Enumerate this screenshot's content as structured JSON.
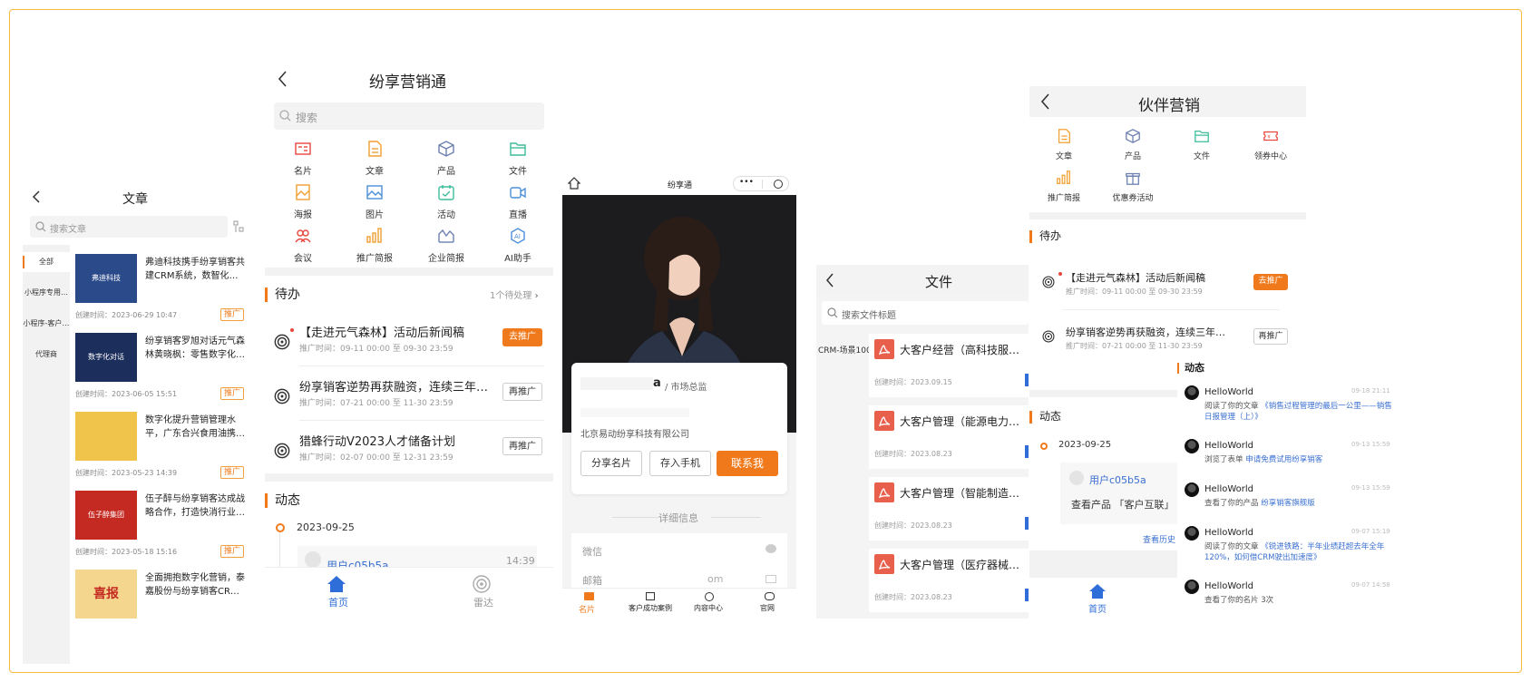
{
  "articles": {
    "title": "文章",
    "search_placeholder": "搜索文章",
    "categories": [
      "全部",
      "小程序专用…",
      "小程序-客户…",
      "代理商"
    ],
    "items": [
      {
        "title": "弗迪科技携手纷享销客共建CRM系统，数智化…",
        "date": "创建时间：2023-06-29 10:47",
        "tag": "推广",
        "thumb_text": "弗迪科技"
      },
      {
        "title": "纷享销客罗旭对话元气森林黄晓枫：零售数字化…",
        "date": "创建时间：2023-06-05 15:51",
        "tag": "推广",
        "thumb_text": "数字化对话"
      },
      {
        "title": "数字化提升营销管理水平，广东合兴食用油携…",
        "date": "创建时间：2023-05-23 14:39",
        "tag": "推广",
        "thumb_text": ""
      },
      {
        "title": "伍子醉与纷享销客达成战略合作，打造快消行业…",
        "date": "创建时间：2023-05-18 15:16",
        "tag": "推广",
        "thumb_text": "伍子醉集团"
      },
      {
        "title": "全面拥抱数字化营销，泰嘉股份与纷享销客CR…",
        "date": "",
        "tag": "",
        "thumb_text": "喜报"
      }
    ]
  },
  "marketing": {
    "title": "纷享营销通",
    "search_placeholder": "搜索",
    "grid": [
      {
        "label": "名片",
        "icon": "card-icon",
        "color": "#e8453c"
      },
      {
        "label": "文章",
        "icon": "doc-icon",
        "color": "#f0a030"
      },
      {
        "label": "产品",
        "icon": "box-icon",
        "color": "#6c7fb0"
      },
      {
        "label": "文件",
        "icon": "folder-icon",
        "color": "#3dbb9a"
      },
      {
        "label": "海报",
        "icon": "poster-icon",
        "color": "#f0a030"
      },
      {
        "label": "图片",
        "icon": "image-icon",
        "color": "#4a8fd8"
      },
      {
        "label": "活动",
        "icon": "event-icon",
        "color": "#3dbb9a"
      },
      {
        "label": "直播",
        "icon": "live-icon",
        "color": "#4a8fd8"
      },
      {
        "label": "会议",
        "icon": "meeting-icon",
        "color": "#e8453c"
      },
      {
        "label": "推广简报",
        "icon": "chart-icon",
        "color": "#f0a030"
      },
      {
        "label": "企业简报",
        "icon": "report-icon",
        "color": "#6c7fb0"
      },
      {
        "label": "AI助手",
        "icon": "ai-icon",
        "color": "#4a8fd8"
      }
    ],
    "todo_title": "待办",
    "todo_count": "1个待处理",
    "todos": [
      {
        "title": "【走进元气森林】活动后新闻稿",
        "time": "推广时间：09-11 00:00 至 09-30 23:59",
        "btn": "去推广",
        "primary": true
      },
      {
        "title": "纷享销客逆势再获融资，连续三年…",
        "time": "推广时间：07-21 00:00 至 11-30 23:59",
        "btn": "再推广",
        "primary": false
      },
      {
        "title": "猎蜂行动V2023人才储备计划",
        "time": "推广时间：02-07 00:00 至 12-31 23:59",
        "btn": "再推广",
        "primary": false
      }
    ],
    "feed_title": "动态",
    "feed_date": "2023-09-25",
    "feed_user": "用户c05b5a",
    "feed_time": "14:39",
    "nav": [
      {
        "label": "首页"
      },
      {
        "label": "雷达"
      }
    ]
  },
  "card": {
    "topbar_title": "纷享通",
    "name_suffix": "a",
    "role": "/ 市场总监",
    "company": "北京易动纷享科技有限公司",
    "btn_share": "分享名片",
    "btn_save": "存入手机",
    "btn_contact": "联系我",
    "detail_title": "详细信息",
    "wechat_label": "微信",
    "email_label": "邮箱",
    "email_tail": "om",
    "nav": [
      "名片",
      "客户成功案例",
      "内容中心",
      "官网"
    ]
  },
  "files": {
    "title": "文件",
    "search_placeholder": "搜索文件标题",
    "category": "CRM-场景100",
    "items": [
      {
        "title": "大客户经营（高科技服务…",
        "date": "创建时间：2023.09.15"
      },
      {
        "title": "大客户管理（能源电力行…",
        "date": "创建时间：2023.08.23"
      },
      {
        "title": "大客户管理（智能制造行业）",
        "date": "创建时间：2023.08.23"
      },
      {
        "title": "大客户管理（医疗器械行…",
        "date": "创建时间：2023.08.23"
      }
    ]
  },
  "partner": {
    "title": "伙伴营销",
    "grid": [
      {
        "label": "文章",
        "icon": "doc-icon",
        "color": "#f0a030"
      },
      {
        "label": "产品",
        "icon": "box-icon",
        "color": "#6c7fb0"
      },
      {
        "label": "文件",
        "icon": "folder-icon",
        "color": "#3dbb9a"
      },
      {
        "label": "领券中心",
        "icon": "coupon-icon",
        "color": "#e8453c"
      },
      {
        "label": "推广简报",
        "icon": "chart-icon",
        "color": "#f0a030"
      },
      {
        "label": "优惠券活动",
        "icon": "gift-icon",
        "color": "#6c7fb0"
      }
    ],
    "todo_title": "待办",
    "todos": [
      {
        "title": "【走进元气森林】活动后新闻稿",
        "time": "推广时间：09-11 00:00 至 09-30 23:59",
        "btn": "去推广",
        "primary": true
      },
      {
        "title": "纷享销客逆势再获融资，连续三年…",
        "time": "推广时间：07-21 00:00 至 11-30 23:59",
        "btn": "再推广",
        "primary": false
      }
    ],
    "feed_title": "动态",
    "feed_date": "2023-09-25",
    "feed_user": "用户c05b5a",
    "feed_text": "查看产品 「客户互联」",
    "history": "查看历史",
    "nav_home": "首页"
  },
  "dynamics": {
    "title": "动态",
    "items": [
      {
        "user": "HelloWorld",
        "time": "09-18 21:11",
        "action": "阅读了你的文章",
        "link": "《销售过程管理的最后一公里——销售日报管理（上）》"
      },
      {
        "user": "HelloWorld",
        "time": "09-13 15:59",
        "action": "浏览了表单",
        "link": "申请免费试用纷享销客"
      },
      {
        "user": "HelloWorld",
        "time": "09-13 15:59",
        "action": "查看了你的产品",
        "link": "纷享销客旗舰版"
      },
      {
        "user": "HelloWorld",
        "time": "09-07 15:19",
        "action": "阅读了你的文章",
        "link": "《锐进铁路：半年业绩赶超去年全年120%，如何借CRM驶出加速度》"
      },
      {
        "user": "HelloWorld",
        "time": "09-07 14:58",
        "action": "查看了你的名片 3次",
        "link": ""
      }
    ]
  }
}
